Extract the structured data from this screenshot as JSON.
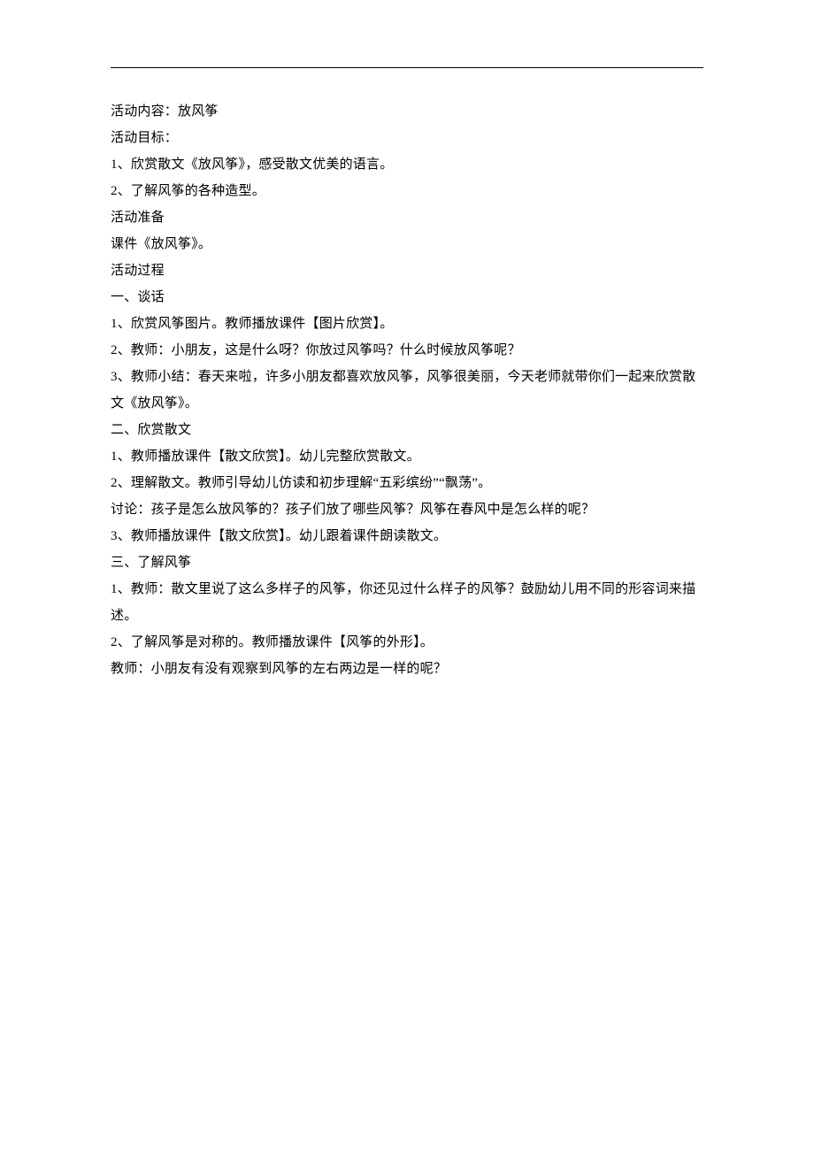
{
  "lines": [
    "活动内容：放风筝",
    "活动目标：",
    "1、欣赏散文《放风筝》，感受散文优美的语言。",
    "2、了解风筝的各种造型。",
    "活动准备",
    "课件《放风筝》。",
    "活动过程",
    "一、谈话",
    "1、欣赏风筝图片。教师播放课件【图片欣赏】。",
    "2、教师：小朋友，这是什么呀？你放过风筝吗？什么时候放风筝呢？",
    "3、教师小结：春天来啦，许多小朋友都喜欢放风筝，风筝很美丽，今天老师就带你们一起来欣赏散文《放风筝》。",
    "二、欣赏散文",
    "1、教师播放课件【散文欣赏】。幼儿完整欣赏散文。",
    "2、理解散文。教师引导幼儿仿读和初步理解“五彩缤纷”“飘荡”。",
    "讨论：孩子是怎么放风筝的？孩子们放了哪些风筝？风筝在春风中是怎么样的呢？",
    "3、教师播放课件【散文欣赏】。幼儿跟着课件朗读散文。",
    "三、了解风筝",
    "1、教师：散文里说了这么多样子的风筝，你还见过什么样子的风筝？鼓励幼儿用不同的形容词来描述。",
    "2、了解风筝是对称的。教师播放课件【风筝的外形】。",
    "教师：小朋友有没有观察到风筝的左右两边是一样的呢？"
  ]
}
